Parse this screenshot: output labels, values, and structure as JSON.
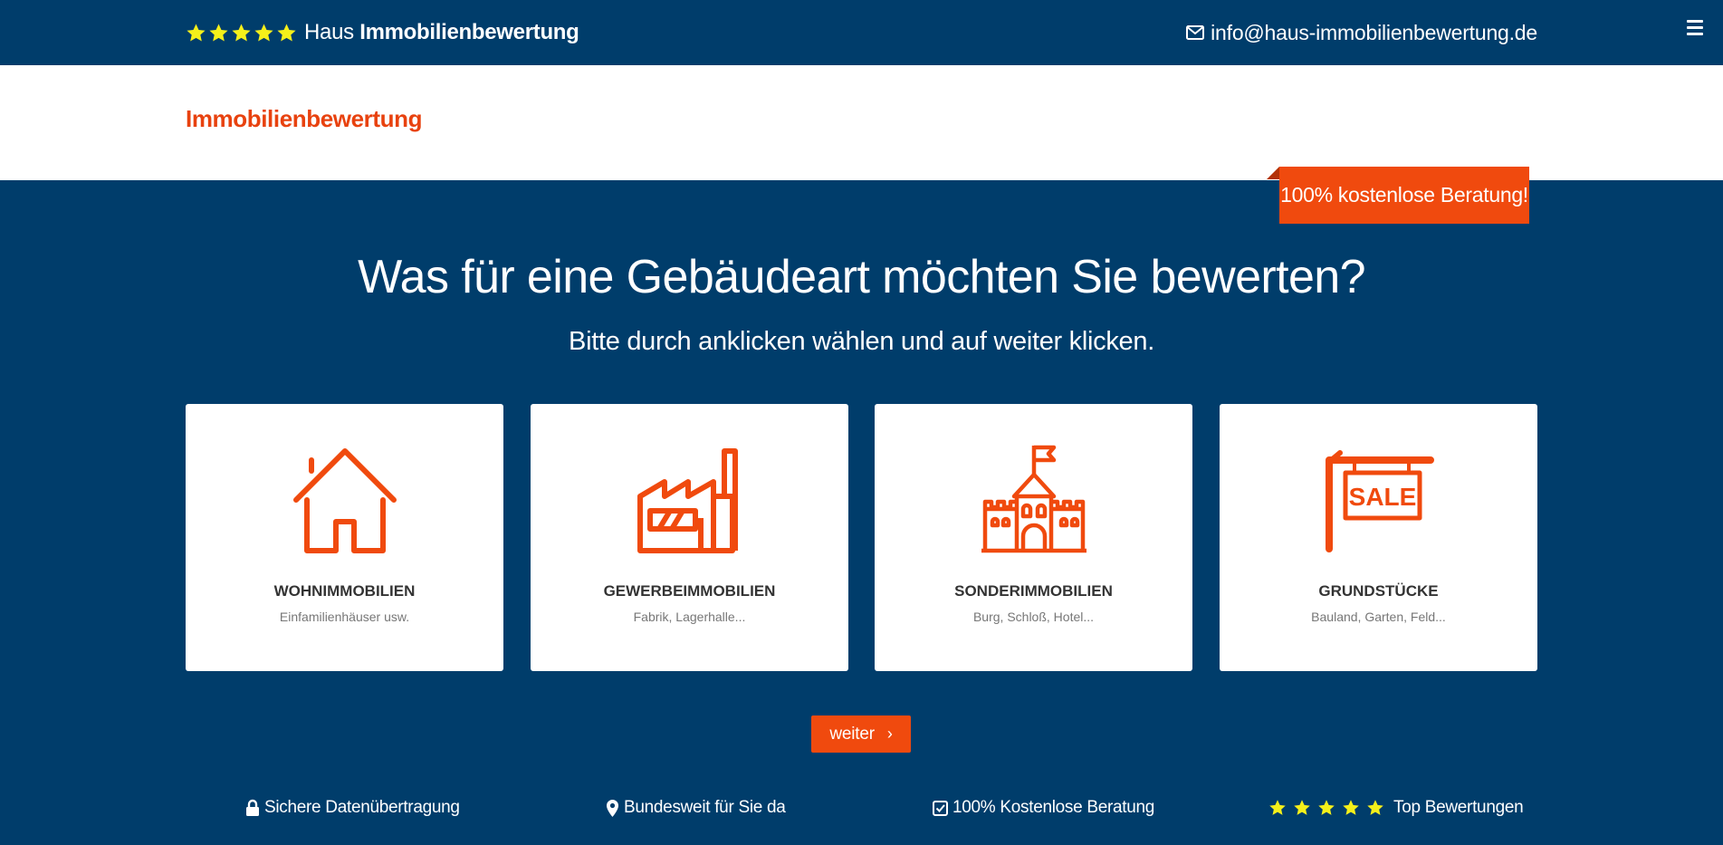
{
  "header": {
    "brand_light": "Haus",
    "brand_bold": "Immobilienbewertung",
    "email": "info@haus-immobilienbewertung.de",
    "rating_stars": 5
  },
  "subheader": {
    "title": "Immobilienbewertung"
  },
  "ribbon": {
    "text": "100% kostenlose Beratung!"
  },
  "main": {
    "title": "Was für eine Gebäudeart möchten Sie bewerten?",
    "subtitle": "Bitte durch anklicken wählen und auf weiter klicken.",
    "cards": [
      {
        "icon": "house-icon",
        "title": "WOHNIMMOBILIEN",
        "desc": "Einfamilienhäuser usw."
      },
      {
        "icon": "factory-icon",
        "title": "GEWERBEIMMOBILIEN",
        "desc": "Fabrik, Lagerhalle..."
      },
      {
        "icon": "castle-icon",
        "title": "SONDERIMMOBILIEN",
        "desc": "Burg, Schloß, Hotel..."
      },
      {
        "icon": "sale-sign-icon",
        "title": "GRUNDSTÜCKE",
        "desc": "Bauland, Garten, Feld..."
      }
    ],
    "sale_sign_text": "SALE",
    "next_button": "weiter",
    "next_chevron": "›"
  },
  "features": [
    {
      "icon": "lock-icon",
      "label": "Sichere Datenübertragung"
    },
    {
      "icon": "map-marker-icon",
      "label": "Bundesweit für Sie da"
    },
    {
      "icon": "checkbox-icon",
      "label": "100% Kostenlose Beratung"
    },
    {
      "icon": "star-icon",
      "label": "Top Bewertungen"
    }
  ],
  "colors": {
    "navy": "#003d6b",
    "orange": "#f04a0e",
    "star_yellow": "#f5f01a"
  }
}
